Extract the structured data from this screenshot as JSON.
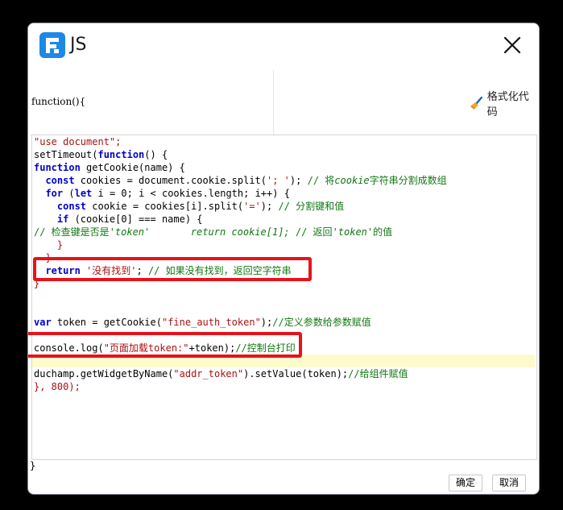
{
  "dialog": {
    "title": "JS",
    "function_signature": "function(){",
    "format_button_label": "格式化代码",
    "closing_brace": "}",
    "confirm_label": "确定",
    "cancel_label": "取消",
    "highlighted_line_index": 17
  },
  "editor": {
    "lines": [
      [
        {
          "t": "\"use document\";",
          "c": "str"
        }
      ],
      [
        {
          "t": "setTimeout(",
          "c": ""
        },
        {
          "t": "function",
          "c": "kw"
        },
        {
          "t": "() {",
          "c": ""
        }
      ],
      [
        {
          "t": "function",
          "c": "kw"
        },
        {
          "t": " getCookie(name) {",
          "c": ""
        }
      ],
      [
        {
          "t": "  ",
          "c": ""
        },
        {
          "t": "const",
          "c": "kw"
        },
        {
          "t": " cookies = document.cookie.split(",
          "c": ""
        },
        {
          "t": "'; '",
          "c": "str"
        },
        {
          "t": "); ",
          "c": ""
        },
        {
          "t": "// 将",
          "c": "cm"
        },
        {
          "t": "cookie",
          "c": "cmi"
        },
        {
          "t": "字符串分割成数组",
          "c": "cm"
        }
      ],
      [
        {
          "t": "  ",
          "c": ""
        },
        {
          "t": "for",
          "c": "kw"
        },
        {
          "t": " (",
          "c": ""
        },
        {
          "t": "let",
          "c": "kw"
        },
        {
          "t": " i = 0; i < cookies.length; i++) {",
          "c": ""
        }
      ],
      [
        {
          "t": "    ",
          "c": ""
        },
        {
          "t": "const",
          "c": "kw"
        },
        {
          "t": " cookie = cookies[i].split(",
          "c": ""
        },
        {
          "t": "'='",
          "c": "str"
        },
        {
          "t": "); ",
          "c": ""
        },
        {
          "t": "// 分割键和值",
          "c": "cm"
        }
      ],
      [
        {
          "t": "    ",
          "c": ""
        },
        {
          "t": "if",
          "c": "kw"
        },
        {
          "t": " (cookie[0] === name) {",
          "c": ""
        }
      ],
      [
        {
          "t": "// 检查键是否是",
          "c": "cm"
        },
        {
          "t": "'token'       return cookie[1]; ",
          "c": "cmi"
        },
        {
          "t": "// 返回",
          "c": "cm"
        },
        {
          "t": "'token'",
          "c": "cmi"
        },
        {
          "t": "的值",
          "c": "cm"
        }
      ],
      [
        {
          "t": "    }",
          "c": "brace"
        }
      ],
      [
        {
          "t": "  }",
          "c": "brace"
        }
      ],
      [
        {
          "t": "  ",
          "c": ""
        },
        {
          "t": "return",
          "c": "kw"
        },
        {
          "t": " ",
          "c": ""
        },
        {
          "t": "'没有找到'",
          "c": "str"
        },
        {
          "t": "; ",
          "c": ""
        },
        {
          "t": "// 如果没有找到，返回空字符串",
          "c": "cm"
        }
      ],
      [
        {
          "t": "}",
          "c": "brace"
        }
      ],
      [
        {
          "t": "",
          "c": ""
        }
      ],
      [
        {
          "t": "",
          "c": ""
        }
      ],
      [
        {
          "t": "var",
          "c": "kw"
        },
        {
          "t": " token = getCookie(",
          "c": ""
        },
        {
          "t": "\"fine_auth_token\"",
          "c": "str"
        },
        {
          "t": ");",
          "c": ""
        },
        {
          "t": "//定义参数给参数赋值",
          "c": "cm"
        }
      ],
      [
        {
          "t": "",
          "c": ""
        }
      ],
      [
        {
          "t": "console.log(",
          "c": ""
        },
        {
          "t": "\"页面加载token:\"",
          "c": "str"
        },
        {
          "t": "+token);",
          "c": ""
        },
        {
          "t": "//控制台打印",
          "c": "cm"
        }
      ],
      [
        {
          "t": "",
          "c": ""
        }
      ],
      [
        {
          "t": "duchamp.getWidgetByName(",
          "c": ""
        },
        {
          "t": "\"addr_token\"",
          "c": "str"
        },
        {
          "t": ").setValue(token);",
          "c": ""
        },
        {
          "t": "//给组件赋值",
          "c": "cm"
        }
      ],
      [
        {
          "t": "}, 800);",
          "c": "brace"
        }
      ]
    ]
  },
  "icons": {
    "logo": "fine-report-logo-icon",
    "close": "close-icon",
    "format": "broom-icon"
  },
  "colors": {
    "keyword": "#0000cc",
    "string": "#aa1111",
    "comment": "#117711",
    "highlight_box": "#e8121a",
    "logo_blue": "#1e88e5"
  }
}
